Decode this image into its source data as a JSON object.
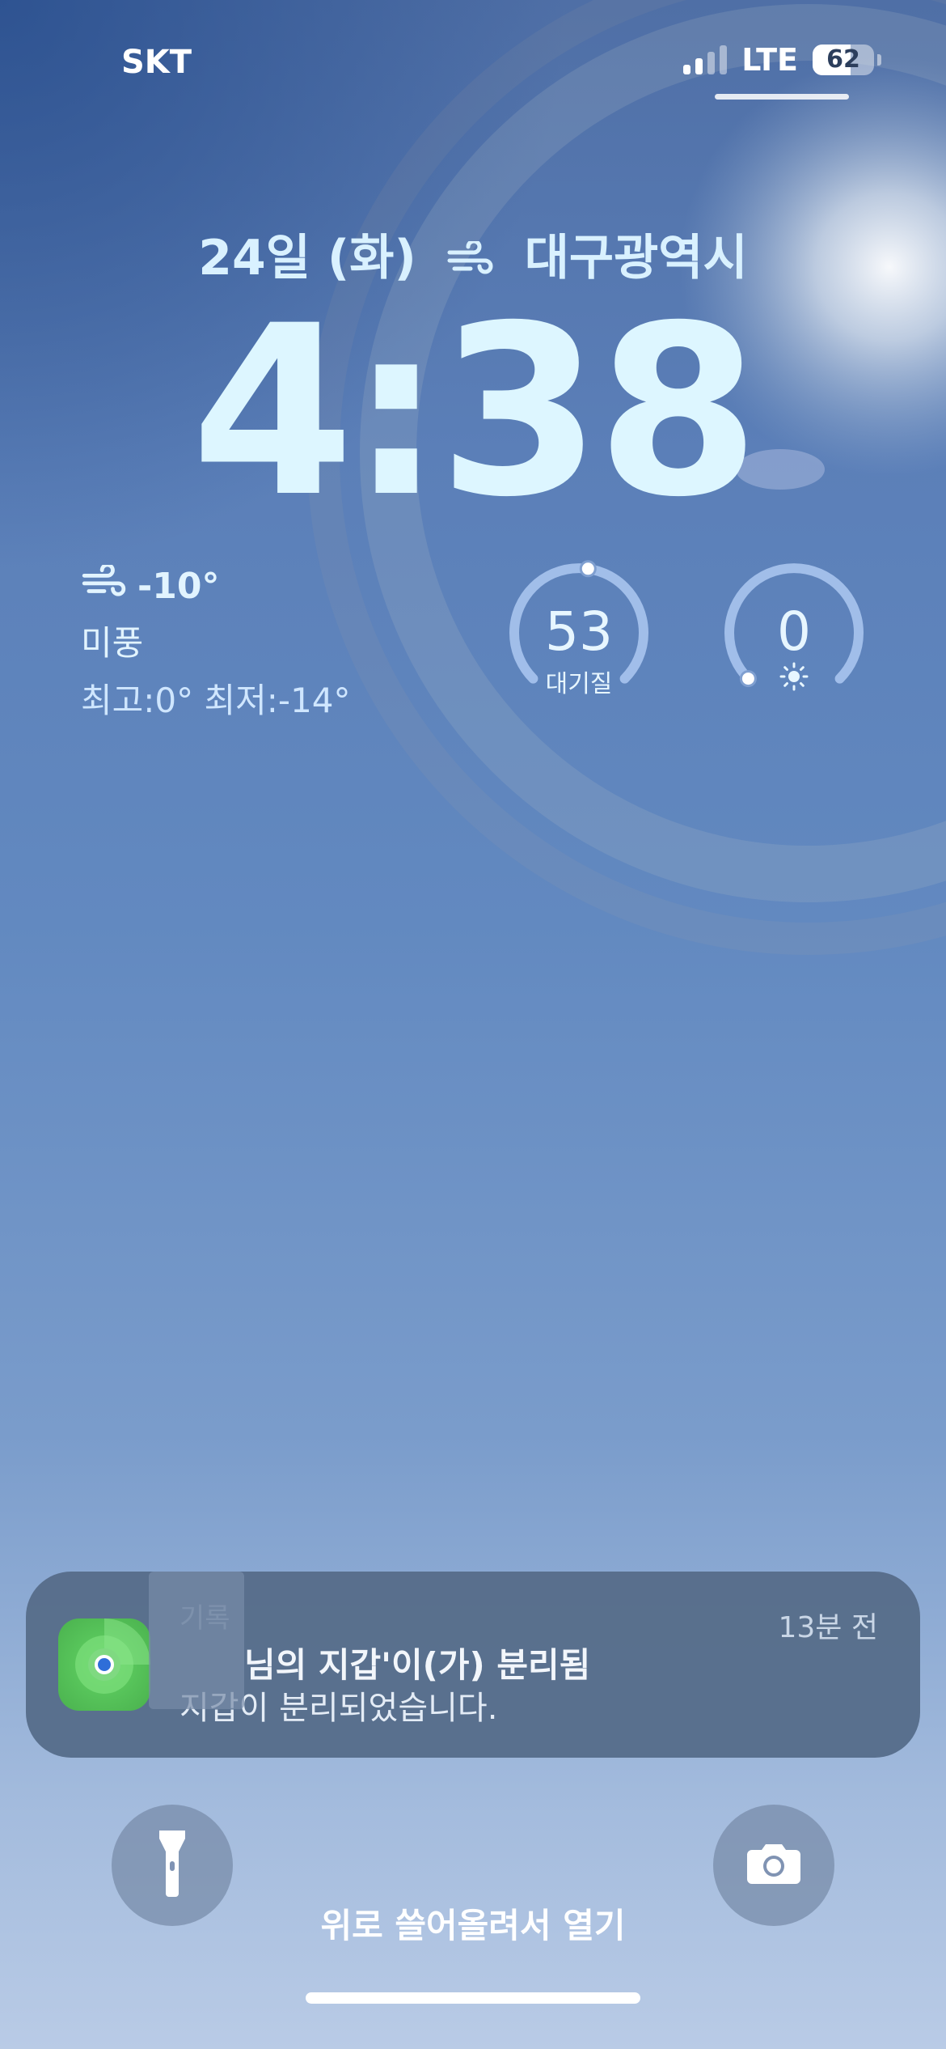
{
  "status_bar": {
    "carrier": "SKT",
    "network": "LTE",
    "battery": "62",
    "battery_level": 0.62,
    "signal_bars_active": 2,
    "signal_bars_total": 4
  },
  "lock_screen": {
    "date": "24일 (화)",
    "location": "대구광역시",
    "time": "4:38",
    "weather": {
      "temperature": "-10°",
      "condition": "미풍",
      "high_low": "최고:0° 최저:-14°",
      "icon": "wind-icon"
    },
    "widgets": [
      {
        "value": "53",
        "label": "대기질",
        "level": 0.53
      },
      {
        "value": "0",
        "label": "",
        "icon": "sun-icon",
        "level": 0.0
      }
    ]
  },
  "notification": {
    "app_name": "기록",
    "title": "님의 지갑'이(가) 분리됨",
    "body": "지갑이 분리되었습니다.",
    "time": "13분 전",
    "app_icon": "find-my-icon"
  },
  "controls": {
    "flashlight_icon": "flashlight-icon",
    "camera_icon": "camera-icon",
    "swipe_hint": "위로 쓸어올려서 열기"
  }
}
